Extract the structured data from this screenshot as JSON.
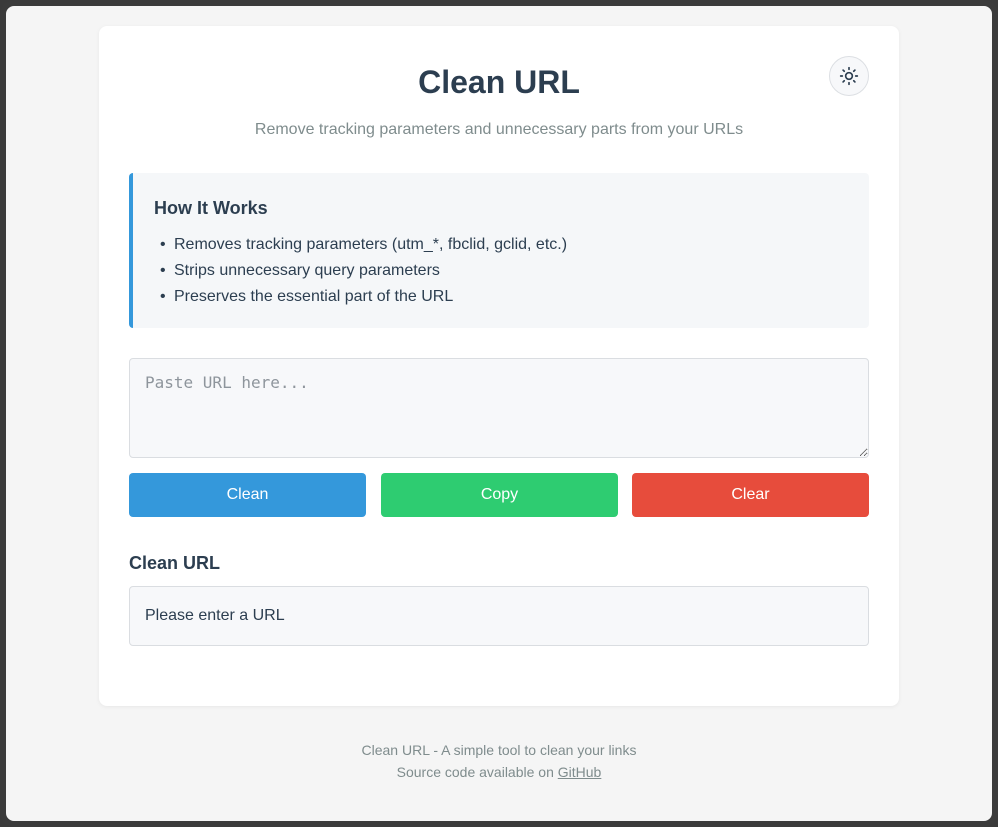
{
  "app": {
    "title": "Clean URL",
    "subtitle": "Remove tracking parameters and unnecessary parts from your URLs"
  },
  "theme_toggle": {
    "icon": "sun-icon"
  },
  "info": {
    "heading": "How It Works",
    "items": [
      "Removes tracking parameters (utm_*, fbclid, gclid, etc.)",
      "Strips unnecessary query parameters",
      "Preserves the essential part of the URL"
    ]
  },
  "input": {
    "placeholder": "Paste URL here...",
    "value": ""
  },
  "buttons": {
    "clean": "Clean",
    "copy": "Copy",
    "clear": "Clear"
  },
  "result": {
    "heading": "Clean URL",
    "text": "Please enter a URL"
  },
  "footer": {
    "line1": "Clean URL - A simple tool to clean your links",
    "line2_prefix": "Source code available on",
    "link_label": "GitHub"
  },
  "colors": {
    "primary": "#3498db",
    "success": "#2ecc71",
    "danger": "#e74c3c",
    "text": "#2c3e50",
    "muted": "#7f8c8d"
  }
}
